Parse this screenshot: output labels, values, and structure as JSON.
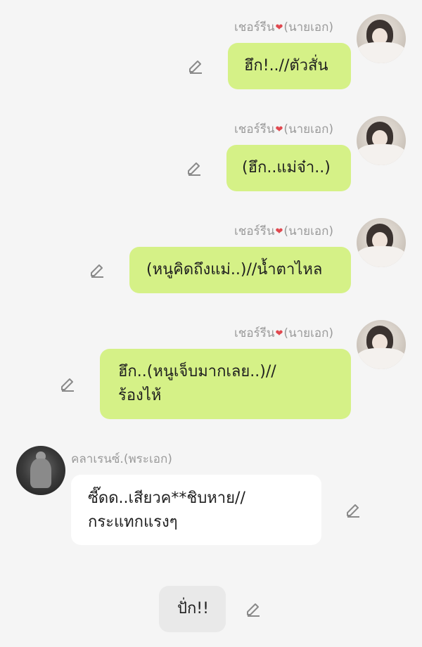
{
  "messages": [
    {
      "sender": "เชอร์รีน",
      "heart": "❤",
      "role": "(นายเอก)",
      "text": "ฮึก!..//ตัวสั่น"
    },
    {
      "sender": "เชอร์รีน",
      "heart": "❤",
      "role": "(นายเอก)",
      "text": "(ฮึก..แม่จ๋า..)"
    },
    {
      "sender": "เชอร์รีน",
      "heart": "❤",
      "role": "(นายเอก)",
      "text": "(หนูคิดถึงแม่..)//น้ำตาไหล"
    },
    {
      "sender": "เชอร์รีน",
      "heart": "❤",
      "role": "(นายเอก)",
      "line1": "ฮึก..(หนูเจ็บมากเลย..)//",
      "line2": "ร้องไห้"
    },
    {
      "sender": "คลาเรนซ์.(พระเอก)",
      "line1": "ซี๊ดด..เสียวค**ชิบหาย//",
      "line2": "กระแทกแรงๆ"
    },
    {
      "text": "ปั่ก!!"
    }
  ],
  "colors": {
    "self_bubble": "#d5f187",
    "other_bubble": "#ffffff",
    "narration_bubble": "#e9e9e9",
    "background": "#f5f5f5"
  },
  "icons": [
    "pencil-edit-icon",
    "heart-icon"
  ]
}
